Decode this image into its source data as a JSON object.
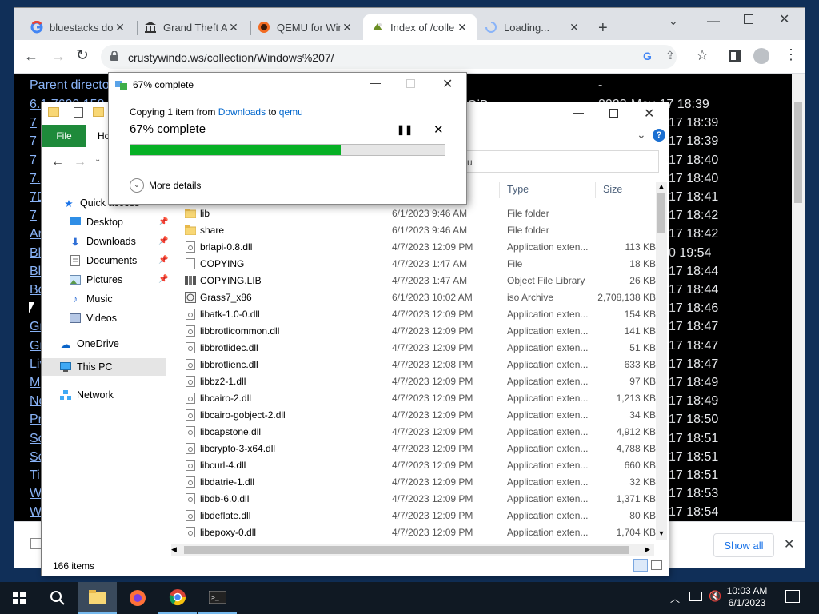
{
  "browser": {
    "tabs": [
      {
        "label": "bluestacks do",
        "icon": "google-icon"
      },
      {
        "label": "Grand Theft A",
        "icon": "museum-icon"
      },
      {
        "label": "QEMU for Win",
        "icon": "qemu-icon"
      },
      {
        "label": "Index of /colle",
        "icon": "site-icon"
      },
      {
        "label": "Loading...",
        "icon": "spinner-icon"
      }
    ],
    "url": "crustywindo.ws/collection/Windows%207/",
    "download_bar": {
      "show_all": "Show all"
    }
  },
  "page": {
    "parent_link": "Parent directo",
    "dash": "-",
    "links": [
      "6.1.7600.158",
      "7",
      "7",
      "7",
      "7.",
      "7D",
      "7",
      "Ar",
      "Bl",
      "Bl",
      "Bo",
      "",
      "Gr",
      "Gr",
      "Liv",
      "M",
      "Ne",
      "Pr",
      "Sc",
      "Se",
      "Ti",
      "W",
      "W"
    ],
    "partial_size": "GiB",
    "dates": [
      "2023-May-17 18:39",
      "17 18:39",
      "17 18:39",
      "17 18:40",
      "17 18:40",
      "17 18:41",
      "17 18:42",
      "17 18:42",
      "0 19:54",
      "17 18:44",
      "17 18:44",
      "17 18:46",
      "17 18:47",
      "17 18:47",
      "17 18:47",
      "17 18:49",
      "17 18:49",
      "17 18:50",
      "17 18:51",
      "17 18:51",
      "17 18:51",
      "17 18:53",
      "17 18:54"
    ]
  },
  "explorer": {
    "file_tab": "File",
    "home_tab": "Ho",
    "search_partial": "u",
    "nav": {
      "quick_access": "Quick access",
      "items": [
        "Desktop",
        "Downloads",
        "Documents",
        "Pictures",
        "Music",
        "Videos"
      ],
      "onedrive": "OneDrive",
      "this_pc": "This PC",
      "network": "Network"
    },
    "columns": {
      "type": "Type",
      "size": "Size"
    },
    "files": [
      {
        "name": "lib",
        "date": "6/1/2023 9:46 AM",
        "type": "File folder",
        "size": "",
        "icon": "folder-icon"
      },
      {
        "name": "share",
        "date": "6/1/2023 9:46 AM",
        "type": "File folder",
        "size": "",
        "icon": "folder-icon"
      },
      {
        "name": "brlapi-0.8.dll",
        "date": "4/7/2023 12:09 PM",
        "type": "Application exten...",
        "size": "113 KB",
        "icon": "dll-icon"
      },
      {
        "name": "COPYING",
        "date": "4/7/2023 1:47 AM",
        "type": "File",
        "size": "18 KB",
        "icon": "file-icon"
      },
      {
        "name": "COPYING.LIB",
        "date": "4/7/2023 1:47 AM",
        "type": "Object File Library",
        "size": "26 KB",
        "icon": "lib-icon"
      },
      {
        "name": "Grass7_x86",
        "date": "6/1/2023 10:02 AM",
        "type": "iso Archive",
        "size": "2,708,138 KB",
        "icon": "iso-icon"
      },
      {
        "name": "libatk-1.0-0.dll",
        "date": "4/7/2023 12:09 PM",
        "type": "Application exten...",
        "size": "154 KB",
        "icon": "dll-icon"
      },
      {
        "name": "libbrotlicommon.dll",
        "date": "4/7/2023 12:09 PM",
        "type": "Application exten...",
        "size": "141 KB",
        "icon": "dll-icon"
      },
      {
        "name": "libbrotlidec.dll",
        "date": "4/7/2023 12:09 PM",
        "type": "Application exten...",
        "size": "51 KB",
        "icon": "dll-icon"
      },
      {
        "name": "libbrotlienc.dll",
        "date": "4/7/2023 12:08 PM",
        "type": "Application exten...",
        "size": "633 KB",
        "icon": "dll-icon"
      },
      {
        "name": "libbz2-1.dll",
        "date": "4/7/2023 12:09 PM",
        "type": "Application exten...",
        "size": "97 KB",
        "icon": "dll-icon"
      },
      {
        "name": "libcairo-2.dll",
        "date": "4/7/2023 12:09 PM",
        "type": "Application exten...",
        "size": "1,213 KB",
        "icon": "dll-icon"
      },
      {
        "name": "libcairo-gobject-2.dll",
        "date": "4/7/2023 12:09 PM",
        "type": "Application exten...",
        "size": "34 KB",
        "icon": "dll-icon"
      },
      {
        "name": "libcapstone.dll",
        "date": "4/7/2023 12:09 PM",
        "type": "Application exten...",
        "size": "4,912 KB",
        "icon": "dll-icon"
      },
      {
        "name": "libcrypto-3-x64.dll",
        "date": "4/7/2023 12:09 PM",
        "type": "Application exten...",
        "size": "4,788 KB",
        "icon": "dll-icon"
      },
      {
        "name": "libcurl-4.dll",
        "date": "4/7/2023 12:09 PM",
        "type": "Application exten...",
        "size": "660 KB",
        "icon": "dll-icon"
      },
      {
        "name": "libdatrie-1.dll",
        "date": "4/7/2023 12:09 PM",
        "type": "Application exten...",
        "size": "32 KB",
        "icon": "dll-icon"
      },
      {
        "name": "libdb-6.0.dll",
        "date": "4/7/2023 12:09 PM",
        "type": "Application exten...",
        "size": "1,371 KB",
        "icon": "dll-icon"
      },
      {
        "name": "libdeflate.dll",
        "date": "4/7/2023 12:09 PM",
        "type": "Application exten...",
        "size": "80 KB",
        "icon": "dll-icon"
      },
      {
        "name": "libepoxy-0.dll",
        "date": "4/7/2023 12:09 PM",
        "type": "Application exten...",
        "size": "1,704 KB",
        "icon": "dll-icon"
      }
    ],
    "status": "166 items"
  },
  "copy_dialog": {
    "title": "67% complete",
    "copy_prefix": "Copying 1 item from ",
    "from": "Downloads",
    "to_word": " to ",
    "to": "qemu",
    "headline": "67% complete",
    "progress": 0.67,
    "more_details": "More details"
  },
  "taskbar": {
    "time": "10:03 AM",
    "date": "6/1/2023"
  },
  "colors": {
    "progress": "#06b025",
    "link": "#8ab4f8",
    "file_tab": "#1e8a3a"
  }
}
